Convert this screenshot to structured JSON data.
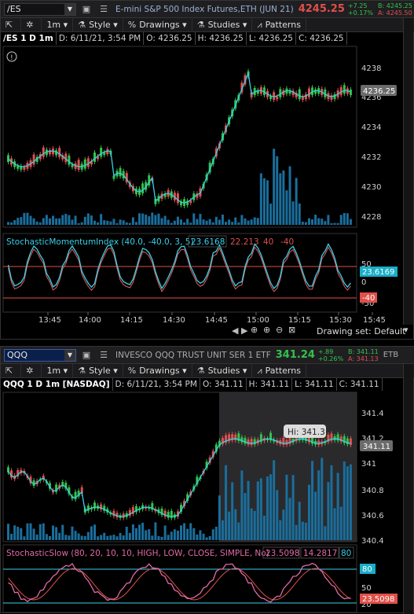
{
  "top": {
    "symbol": "/ES",
    "description": "E-mini S&P 500 Index Futures,ETH (JUN 21)",
    "last": "4245.25",
    "change": "+7.25",
    "change_pct": "+0.17%",
    "bid": "B: 4245.25",
    "ask": "A: 4245.50",
    "timeframe": "1m",
    "style_label": "Style",
    "drawings_label": "Drawings",
    "studies_label": "Studies",
    "patterns_label": "Patterns",
    "chart_title": "/ES 1 D 1m",
    "info": [
      "D: 6/11/21, 3:54 PM",
      "O: 4236.25",
      "H: 4236.25",
      "L: 4236.25",
      "C: 4236.25"
    ],
    "price_ticks": [
      "4238",
      "4236",
      "4234",
      "4232",
      "4230",
      "4228"
    ],
    "price_badge": "4236.25",
    "study_name": "StochasticMomentumIndex (40.0, -40.0, 3, 5)",
    "study_v1": "23.6168",
    "study_v2": "22.213",
    "study_v3": "40",
    "study_v4": "-40",
    "study_ticks": [
      "50",
      "0",
      "-50"
    ],
    "study_badge": "23.6169",
    "study_badge_low": "-40",
    "time_ticks": [
      "13:45",
      "14:00",
      "14:15",
      "14:30",
      "14:45",
      "15:00",
      "15:15",
      "15:30",
      "15:45"
    ],
    "drawing_set": "Drawing set: Default",
    "colors": {
      "up": "#35c24a",
      "down": "#e0504a",
      "avg": "#3ad0e8",
      "volume": "#1a6e9c",
      "accent": "#e05050"
    }
  },
  "bottom": {
    "symbol": "QQQ",
    "description": "INVESCO QQQ TRUST UNIT SER 1 ETF",
    "last": "341.24",
    "change": "+.89",
    "change_pct": "+0.26%",
    "bid": "B: 341.11",
    "ask": "A: 341.13",
    "exchange": "ETB",
    "timeframe": "1m",
    "style_label": "Style",
    "drawings_label": "Drawings",
    "studies_label": "Studies",
    "patterns_label": "Patterns",
    "chart_title": "QQQ 1 D 1m [NASDAQ]",
    "info": [
      "D: 6/11/21, 3:54 PM",
      "O: 341.11",
      "H: 341.11",
      "L: 341.11",
      "C: 341.11"
    ],
    "price_ticks": [
      "341.4",
      "341.2",
      "341",
      "340.8",
      "340.6",
      "340.4"
    ],
    "price_badge": "341.11",
    "hi_label": "Hi: 341.3",
    "study_name": "StochasticSlow (80, 20, 10, 10, HIGH, LOW, CLOSE, SIMPLE, No)",
    "study_v1": "23.5098",
    "study_v2": "14.2817",
    "study_v3": "80",
    "study_ticks": [
      "80",
      "50",
      "20"
    ],
    "study_badge_top": "80",
    "study_badge": "23.5098",
    "colors": {
      "k_line": "#e06aa8",
      "d_line": "#e0504a",
      "band": "#3ad0e8"
    }
  }
}
